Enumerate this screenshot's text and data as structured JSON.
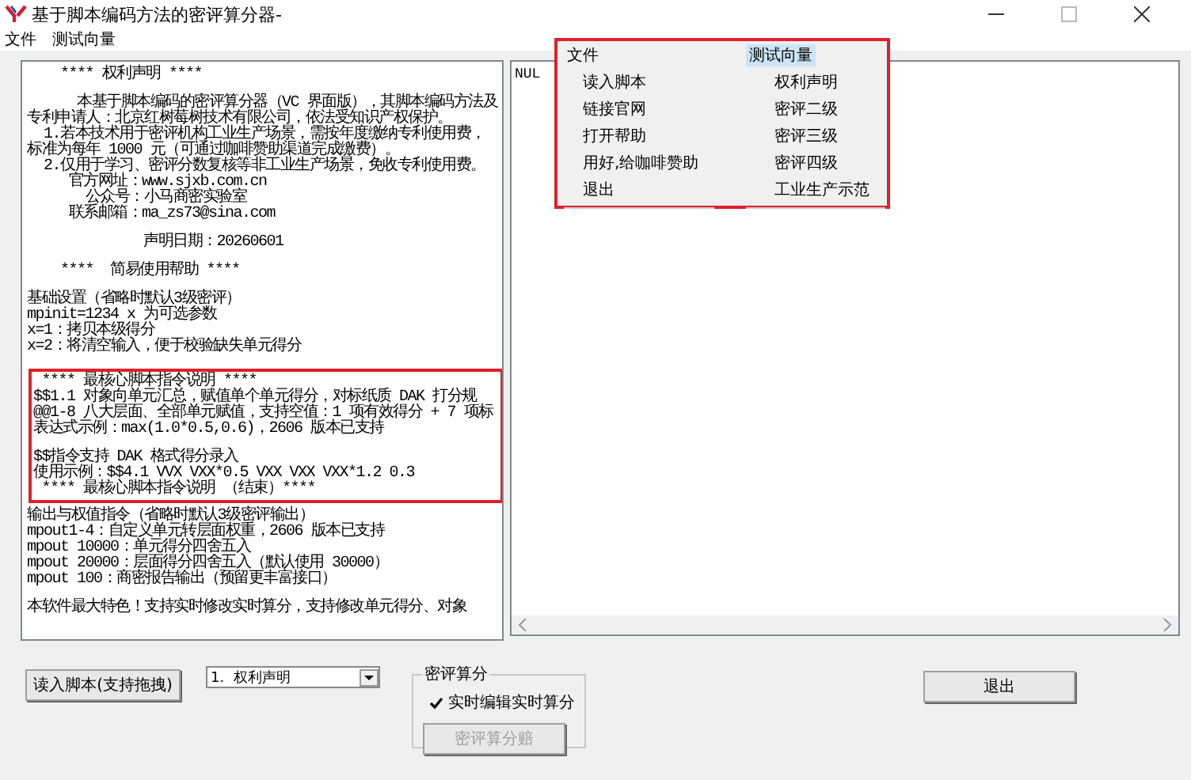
{
  "window": {
    "title": "基于脚本编码方法的密评算分器-"
  },
  "menu_bar": [
    "文件",
    "测试向量"
  ],
  "script_text": {
    "sections": [
      {
        "highlighted": false,
        "blocks": [
          [
            "    **** 权利声明 ****"
          ],
          [
            "      本基于脚本编码的密评算分器（VC 界面版），其脚本编码方法及",
            "专利申请人：北京红树莓树技术有限公司，依法受知识产权保护。",
            "  1.若本技术用于密评机构工业生产场景，需按年度缴纳专利使用费，",
            "标准为每年 1000 元（可通过咖啡赞助渠道完成缴费）。",
            "  2.仅用于学习、密评分数复核等非工业生产场景，免收专利使用费。",
            "     官方网址：www.sjxb.com.cn",
            "       公众号：小马商密实验室",
            "     联系邮箱：ma_zs73@sina.com"
          ],
          [
            "              声明日期：20260601"
          ],
          [
            "    ****  简易使用帮助 ****"
          ],
          [
            "基础设置（省略时默认3级密评）",
            "mpinit=1234 x 为可选参数",
            "x=1：拷贝本级得分",
            "x=2：将清空输入，便于校验缺失单元得分"
          ]
        ]
      },
      {
        "highlighted": true,
        "blocks": [
          [
            " **** 最核心脚本指令说明 ****",
            "$$1.1 对象向单元汇总，赋值单个单元得分，对标纸质 DAK 打分规",
            "@@1-8 八大层面、全部单元赋值，支持空值：1 项有效得分 + 7 项标",
            "表达式示例：max(1.0*0.5,0.6)，2606 版本已支持"
          ],
          [
            "$$指令支持 DAK 格式得分录入",
            "使用示例：$$4.1 VVX VXX*0.5 VXX VXX VXX*1.2 0.3",
            " **** 最核心脚本指令说明 （结束）****"
          ]
        ]
      },
      {
        "highlighted": false,
        "blocks": [
          [
            "输出与权值指令（省略时默认3级密评输出）",
            "mpout1-4：自定义单元转层面权重，2606 版本已支持",
            "mpout 10000：单元得分四舍五入",
            "mpout 20000：层面得分四舍五入（默认使用 30000）",
            "mpout 100：商密报告输出（预留更丰富接口）"
          ],
          [
            "本软件最大特色！支持实时修改实时算分，支持修改单元得分、对象"
          ]
        ]
      }
    ]
  },
  "output_text": "NUL",
  "menu_overlay": {
    "highlighted": true,
    "menus": [
      {
        "title": "文件",
        "selected": false,
        "items": [
          "读入脚本",
          "链接官网",
          "打开帮助",
          "用好,给咖啡赞助",
          "退出"
        ]
      },
      {
        "title": "测试向量",
        "selected": true,
        "items": [
          "权利声明",
          "密评二级",
          "密评三级",
          "密评四级",
          "工业生产示范"
        ]
      }
    ]
  },
  "load_button": "读入脚本(支持拖拽)",
  "script_select": {
    "value": "1.  权利声明"
  },
  "scoring_group": {
    "title": "密评算分",
    "realtime": {
      "label": "实时编辑实时算分",
      "checked": true
    },
    "score_button": {
      "label": "密评算分赔",
      "disabled": true
    }
  },
  "exit_button": "退出"
}
